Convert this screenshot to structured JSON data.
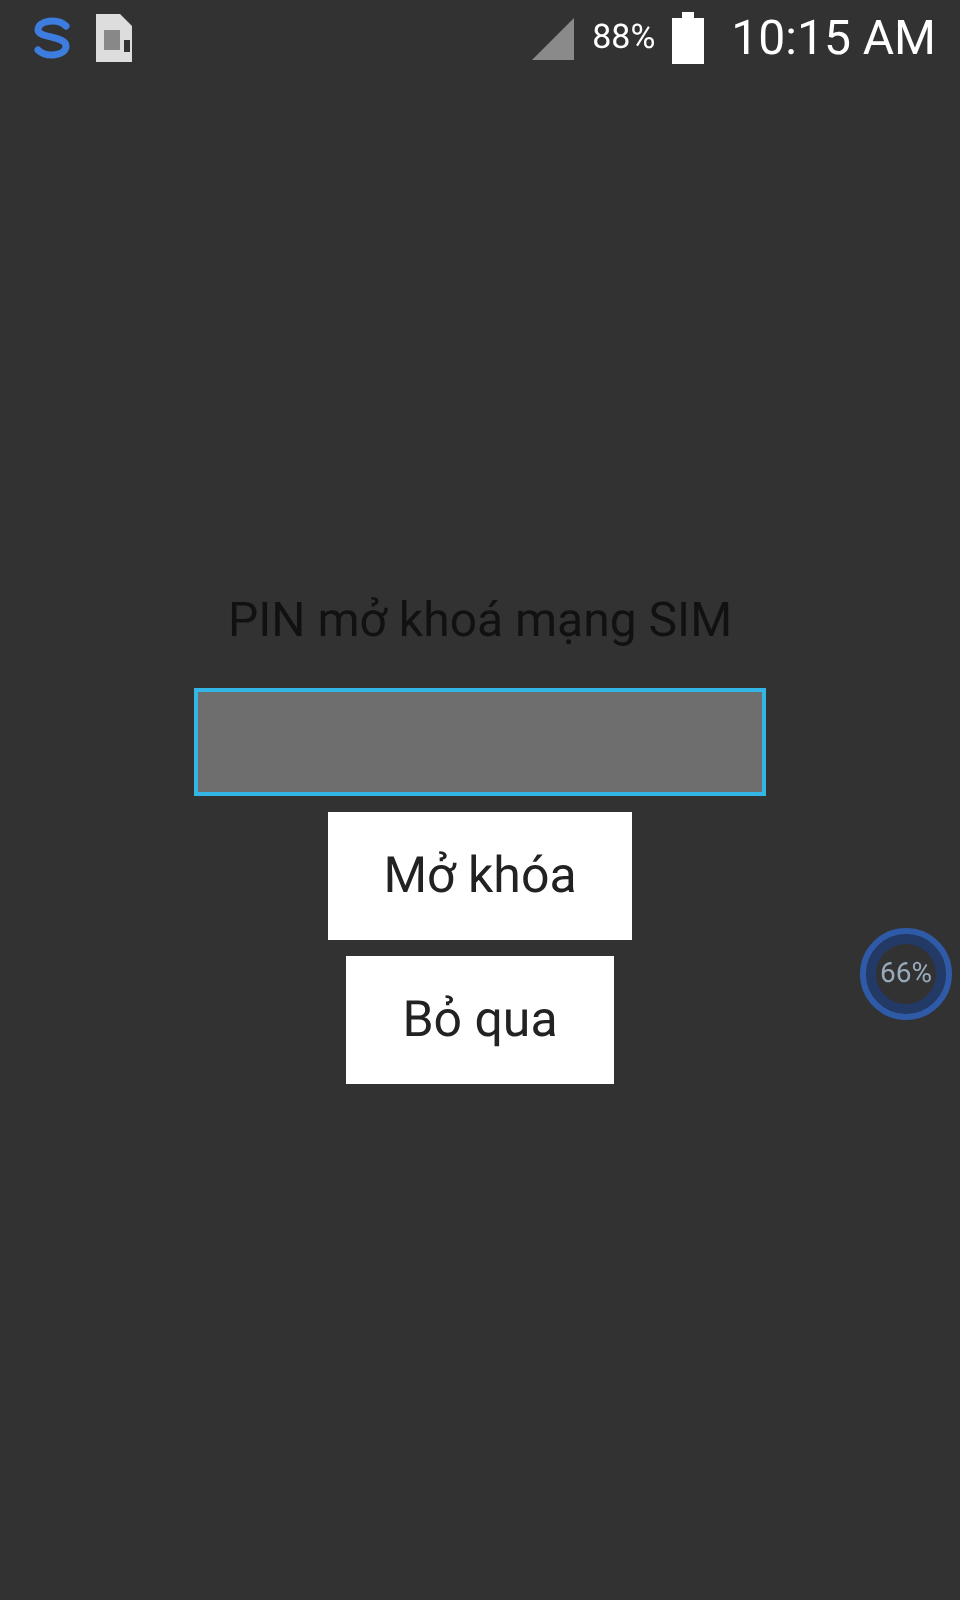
{
  "status_bar": {
    "battery_percent": "88%",
    "time": "10:15 AM"
  },
  "unlock": {
    "title": "PIN mở khoá mạng SIM",
    "buttons": [
      {
        "label": "Mở khóa"
      },
      {
        "label": "Bỏ qua"
      }
    ]
  },
  "floating_widget": {
    "label": "66%"
  }
}
